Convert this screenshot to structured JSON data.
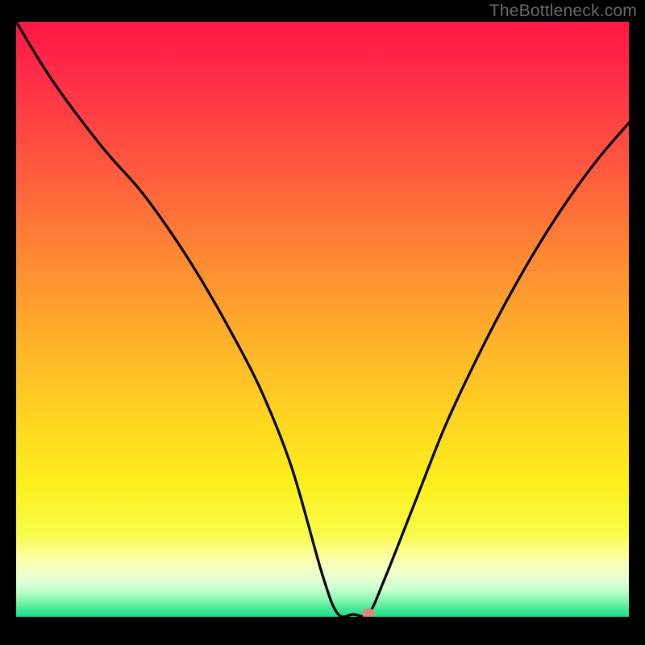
{
  "watermark": "TheBottleneck.com",
  "chart_data": {
    "type": "line",
    "title": "",
    "xlabel": "",
    "ylabel": "",
    "xlim_fraction": [
      0,
      1
    ],
    "ylim_fraction": [
      0,
      1
    ],
    "description": "Bottleneck curve: y = mismatch percentage (0 at balance point). Curve falls steeply from upper-left, reaches zero around x≈0.55, then rises toward upper-right.",
    "series": [
      {
        "name": "bottleneck-curve",
        "x_fraction": [
          0.0,
          0.06,
          0.14,
          0.2,
          0.25,
          0.3,
          0.35,
          0.4,
          0.45,
          0.5,
          0.525,
          0.55,
          0.575,
          0.6,
          0.65,
          0.7,
          0.75,
          0.8,
          0.85,
          0.9,
          0.95,
          1.0
        ],
        "y_fraction": [
          1.0,
          0.9,
          0.79,
          0.72,
          0.65,
          0.57,
          0.48,
          0.38,
          0.25,
          0.07,
          0.005,
          0.004,
          0.005,
          0.06,
          0.19,
          0.32,
          0.43,
          0.53,
          0.62,
          0.7,
          0.77,
          0.83
        ]
      }
    ],
    "marker": {
      "x_fraction": 0.575,
      "y_fraction": 0.005,
      "color": "#d88a7b"
    },
    "background_gradient_stops": [
      {
        "offset": 0.0,
        "color": "#ff1744"
      },
      {
        "offset": 0.1,
        "color": "#ff2f47"
      },
      {
        "offset": 0.25,
        "color": "#ff5a3e"
      },
      {
        "offset": 0.4,
        "color": "#ff8a33"
      },
      {
        "offset": 0.55,
        "color": "#ffb528"
      },
      {
        "offset": 0.68,
        "color": "#ffd820"
      },
      {
        "offset": 0.78,
        "color": "#fdef1e"
      },
      {
        "offset": 0.86,
        "color": "#f8fb47"
      },
      {
        "offset": 0.905,
        "color": "#fdffb0"
      },
      {
        "offset": 0.935,
        "color": "#e8ffd3"
      },
      {
        "offset": 0.955,
        "color": "#c4ffcf"
      },
      {
        "offset": 0.972,
        "color": "#86f7b0"
      },
      {
        "offset": 0.985,
        "color": "#4de999"
      },
      {
        "offset": 1.0,
        "color": "#18e08b"
      }
    ]
  }
}
